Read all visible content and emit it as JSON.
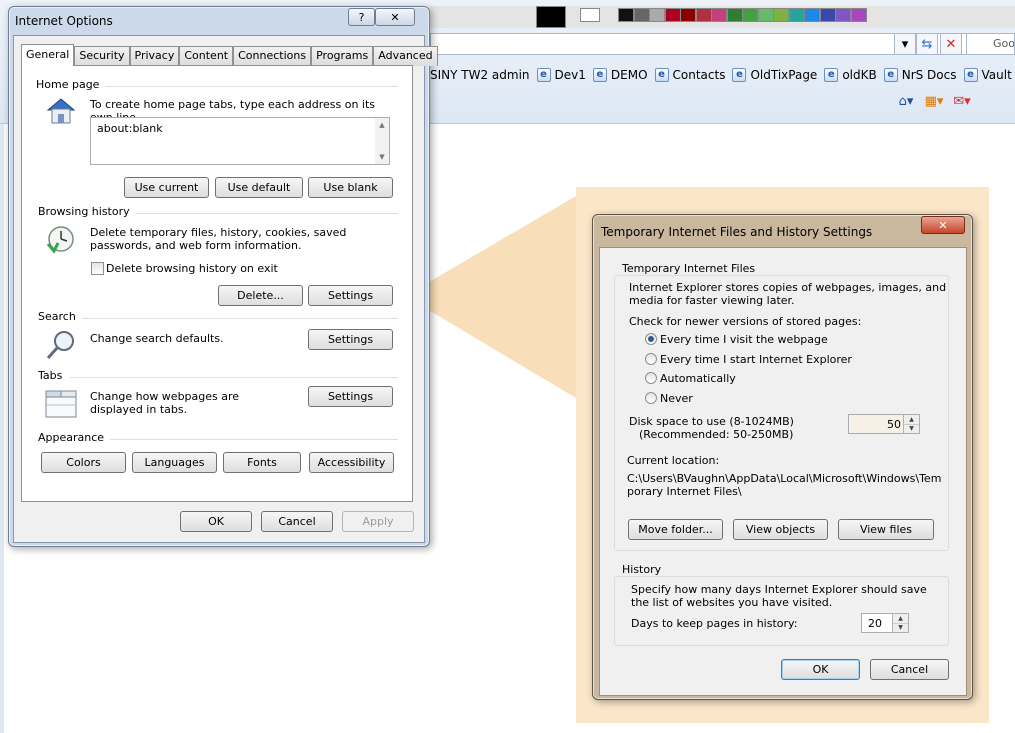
{
  "browser": {
    "address_placeholder": "",
    "search_text": "Goo",
    "favorites": [
      "SINY TW2 admin",
      "Dev1",
      "DEMO",
      "Contacts",
      "OldTixPage",
      "oldKB",
      "NrS Docs",
      "Vault"
    ],
    "swatch_colors": [
      "#000000",
      "#ffffff",
      "#111111",
      "#666666",
      "#aaaaaa",
      "#b00020",
      "#8b0000",
      "#b03040",
      "#c04080",
      "#2e7d32",
      "#43a047",
      "#66bb6a",
      "#7cb342",
      "#26a69a",
      "#1e88e5",
      "#3949ab",
      "#7e57c2",
      "#ab47bc"
    ]
  },
  "internet_options": {
    "title": "Internet Options",
    "help_label": "?",
    "close_label": "✕",
    "tabs": [
      "General",
      "Security",
      "Privacy",
      "Content",
      "Connections",
      "Programs",
      "Advanced"
    ],
    "active_tab": "General",
    "home_page": {
      "heading": "Home page",
      "description": "To create home page tabs, type each address on its own line.",
      "value": "about:blank",
      "use_current": "Use current",
      "use_default": "Use default",
      "use_blank": "Use blank"
    },
    "browsing_history": {
      "heading": "Browsing history",
      "description": "Delete temporary files, history, cookies, saved passwords, and web form information.",
      "checkbox_label": "Delete browsing history on exit",
      "checkbox_checked": false,
      "delete_label": "Delete...",
      "settings_label": "Settings"
    },
    "search": {
      "heading": "Search",
      "description": "Change search defaults.",
      "settings_label": "Settings"
    },
    "tabs_section": {
      "heading": "Tabs",
      "description": "Change how webpages are displayed in tabs.",
      "settings_label": "Settings"
    },
    "appearance": {
      "heading": "Appearance",
      "colors": "Colors",
      "languages": "Languages",
      "fonts": "Fonts",
      "accessibility": "Accessibility"
    },
    "ok": "OK",
    "cancel": "Cancel",
    "apply": "Apply"
  },
  "tif_settings": {
    "title": "Temporary Internet Files and History Settings",
    "close_label": "✕",
    "tif_group": {
      "heading": "Temporary Internet Files",
      "description": "Internet Explorer stores copies of webpages, images, and media for faster viewing later.",
      "check_label": "Check for newer versions of stored pages:",
      "options": [
        "Every time I visit the webpage",
        "Every time I start Internet Explorer",
        "Automatically",
        "Never"
      ],
      "selected_index": 0,
      "disk_label": "Disk space to use (8-1024MB)",
      "disk_recommended": "(Recommended: 50-250MB)",
      "disk_value": "50",
      "location_label": "Current location:",
      "location_value": "C:\\Users\\BVaughn\\AppData\\Local\\Microsoft\\Windows\\Temporary Internet Files\\",
      "move_folder": "Move folder...",
      "view_objects": "View objects",
      "view_files": "View files"
    },
    "history_group": {
      "heading": "History",
      "description": "Specify how many days Internet Explorer should save the list of websites you have visited.",
      "days_label": "Days to keep pages in history:",
      "days_value": "20"
    },
    "ok": "OK",
    "cancel": "Cancel"
  }
}
